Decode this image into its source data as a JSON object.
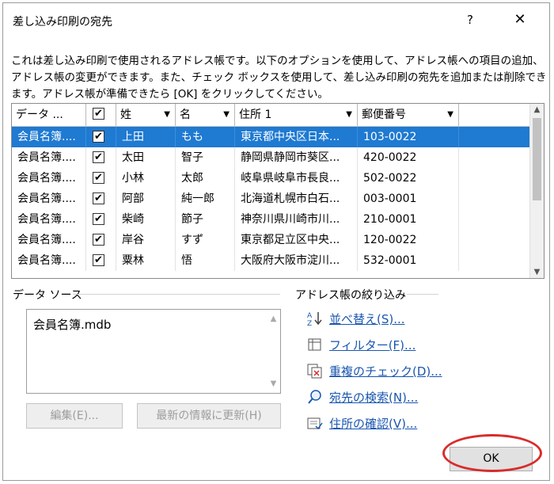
{
  "window": {
    "title": "差し込み印刷の宛先",
    "help_label": "?",
    "close_label": "✕"
  },
  "description": "これは差し込み印刷で使用されるアドレス帳です。以下のオプションを使用して、アドレス帳への項目の追加、アドレス帳の変更ができます。また、チェック ボックスを使用して、差し込み印刷の宛先を追加または削除できます。アドレス帳が準備できたら [OK] をクリックしてください。",
  "grid": {
    "columns": [
      "データ ...",
      "",
      "姓",
      "名",
      "住所 1",
      "郵便番号"
    ],
    "rows": [
      {
        "source": "会員名簿....",
        "checked": "✔",
        "last": "上田",
        "first": "もも",
        "address": "東京都中央区日本...",
        "zip": "103-0022",
        "selected": true
      },
      {
        "source": "会員名簿....",
        "checked": "✔",
        "last": "太田",
        "first": "智子",
        "address": "静岡県静岡市葵区...",
        "zip": "420-0022",
        "selected": false
      },
      {
        "source": "会員名簿....",
        "checked": "✔",
        "last": "小林",
        "first": "太郎",
        "address": "岐阜県岐阜市長良...",
        "zip": "502-0022",
        "selected": false
      },
      {
        "source": "会員名簿....",
        "checked": "✔",
        "last": "阿部",
        "first": "純一郎",
        "address": "北海道札幌市白石...",
        "zip": "003-0001",
        "selected": false
      },
      {
        "source": "会員名簿....",
        "checked": "✔",
        "last": "柴崎",
        "first": "節子",
        "address": "神奈川県川崎市川...",
        "zip": "210-0001",
        "selected": false
      },
      {
        "source": "会員名簿....",
        "checked": "✔",
        "last": "岸谷",
        "first": "すず",
        "address": "東京都足立区中央...",
        "zip": "120-0022",
        "selected": false
      },
      {
        "source": "会員名簿....",
        "checked": "✔",
        "last": "粟林",
        "first": "悟",
        "address": "大阪府大阪市淀川...",
        "zip": "532-0001",
        "selected": false
      }
    ],
    "selected_color": "#1f7ad1"
  },
  "data_source": {
    "label": "データ ソース",
    "items": [
      "会員名簿.mdb"
    ],
    "edit_button": "編集(E)...",
    "refresh_button": "最新の情報に更新(H)"
  },
  "filter": {
    "label": "アドレス帳の絞り込み",
    "links": [
      {
        "label": "並べ替え(S)...",
        "icon": "sort-icon"
      },
      {
        "label": "フィルター(F)...",
        "icon": "filter-icon"
      },
      {
        "label": "重複のチェック(D)...",
        "icon": "duplicate-check-icon"
      },
      {
        "label": "宛先の検索(N)...",
        "icon": "find-recipient-icon"
      },
      {
        "label": "住所の確認(V)...",
        "icon": "validate-address-icon"
      }
    ]
  },
  "ok_button": "OK",
  "highlight_color": "#d82c2c"
}
